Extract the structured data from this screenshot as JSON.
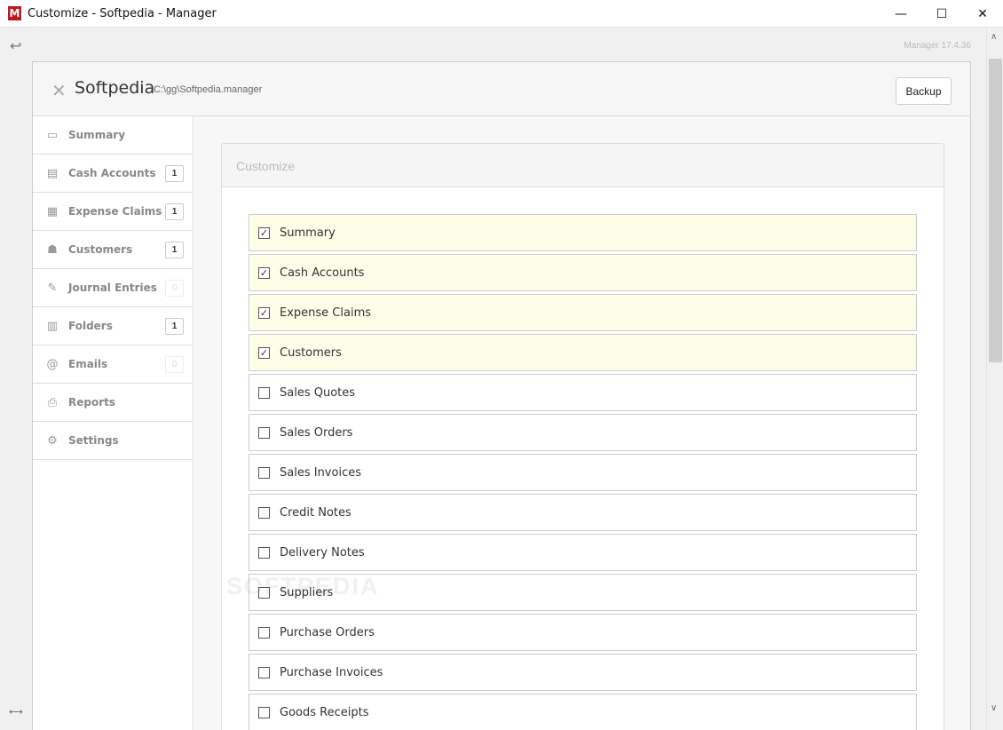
{
  "window": {
    "logo_letter": "M",
    "title": "Customize - Softpedia - Manager",
    "minimize": "—",
    "maximize": "☐",
    "close": "✕"
  },
  "toolbar": {
    "back_icon": "↩",
    "version": "Manager 17.4.36",
    "expand_icon": "⟷"
  },
  "header": {
    "close_icon": "✕",
    "business_name": "Softpedia",
    "business_path": "C:\\gg\\Softpedia.manager",
    "backup_label": "Backup"
  },
  "sidebar": {
    "items": [
      {
        "label": "Summary",
        "icon": "presentation-icon",
        "glyph": "▭",
        "count": null
      },
      {
        "label": "Cash Accounts",
        "icon": "cash-register-icon",
        "glyph": "▤",
        "count": "1"
      },
      {
        "label": "Expense Claims",
        "icon": "expense-icon",
        "glyph": "▦",
        "count": "1"
      },
      {
        "label": "Customers",
        "icon": "people-icon",
        "glyph": "☗",
        "count": "1"
      },
      {
        "label": "Journal Entries",
        "icon": "quill-icon",
        "glyph": "✎",
        "count": "0"
      },
      {
        "label": "Folders",
        "icon": "folder-icon",
        "glyph": "▥",
        "count": "1"
      },
      {
        "label": "Emails",
        "icon": "at-icon",
        "glyph": "@",
        "count": "0"
      },
      {
        "label": "Reports",
        "icon": "printer-icon",
        "glyph": "⎙",
        "count": null
      },
      {
        "label": "Settings",
        "icon": "gears-icon",
        "glyph": "⚙",
        "count": null
      }
    ]
  },
  "customize": {
    "title": "Customize",
    "check_glyph": "✓",
    "options": [
      {
        "label": "Summary",
        "checked": true
      },
      {
        "label": "Cash Accounts",
        "checked": true
      },
      {
        "label": "Expense Claims",
        "checked": true
      },
      {
        "label": "Customers",
        "checked": true
      },
      {
        "label": "Sales Quotes",
        "checked": false
      },
      {
        "label": "Sales Orders",
        "checked": false
      },
      {
        "label": "Sales Invoices",
        "checked": false
      },
      {
        "label": "Credit Notes",
        "checked": false
      },
      {
        "label": "Delivery Notes",
        "checked": false
      },
      {
        "label": "Suppliers",
        "checked": false
      },
      {
        "label": "Purchase Orders",
        "checked": false
      },
      {
        "label": "Purchase Invoices",
        "checked": false
      },
      {
        "label": "Goods Receipts",
        "checked": false
      }
    ]
  },
  "watermark": "SOFTPEDIA",
  "scrollbar": {
    "up_icon": "∧",
    "down_icon": "∨"
  }
}
